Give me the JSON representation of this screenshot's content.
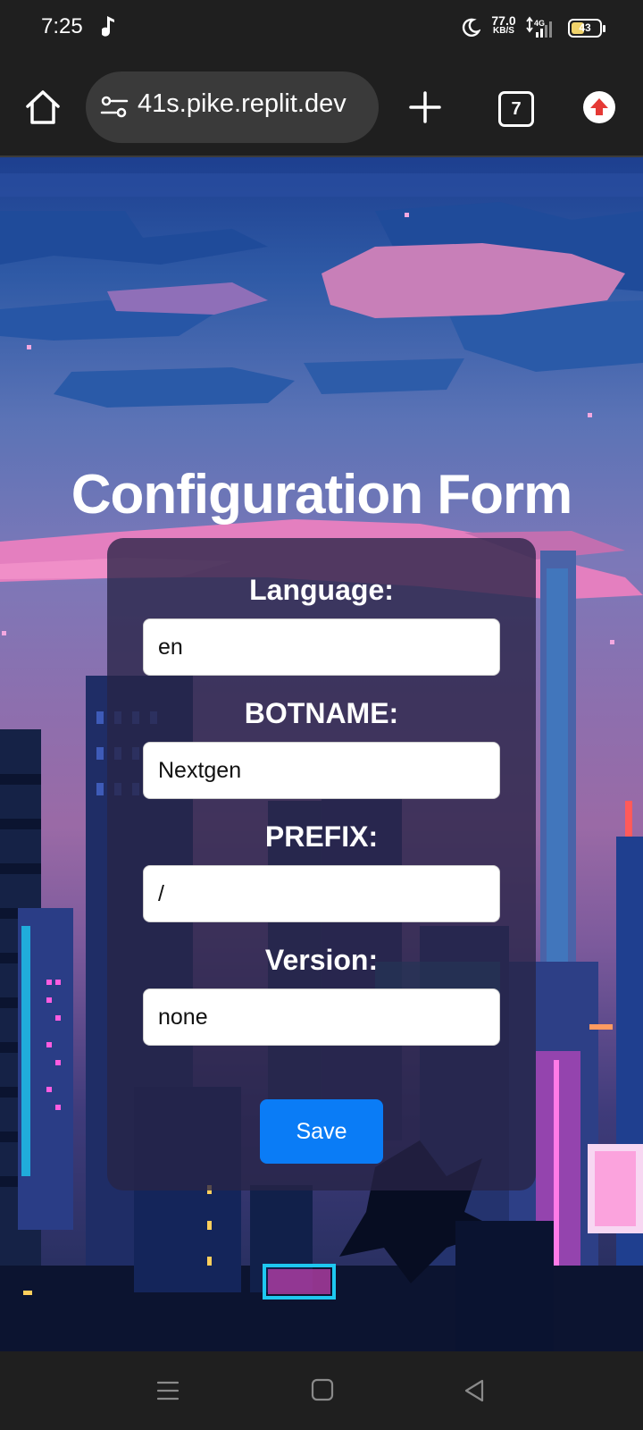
{
  "status_bar": {
    "time": "7:25",
    "net_speed_value": "77.0",
    "net_speed_unit": "KB/S",
    "network_type": "4G",
    "battery_level": "43",
    "icons": [
      "music-note-icon",
      "moon-icon",
      "signal-icon",
      "battery-icon"
    ]
  },
  "browser": {
    "url": "41s.pike.replit.dev",
    "tab_count": "7",
    "icons": [
      "home-icon",
      "site-settings-icon",
      "plus-icon",
      "tabs-icon",
      "update-arrow-icon"
    ]
  },
  "page": {
    "title": "Configuration Form",
    "fields": [
      {
        "label": "Language:",
        "value": "en"
      },
      {
        "label": "BOTNAME:",
        "value": "Nextgen"
      },
      {
        "label": "PREFIX:",
        "value": "/"
      },
      {
        "label": "Version:",
        "value": "none"
      }
    ],
    "save_label": "Save"
  },
  "colors": {
    "button_blue": "#0a7cf6",
    "card_bg": "rgba(40,36,70,0.78)",
    "update_red": "#e53935"
  },
  "nav_bar": {
    "icons": [
      "menu-icon",
      "home-square-icon",
      "back-icon"
    ]
  }
}
